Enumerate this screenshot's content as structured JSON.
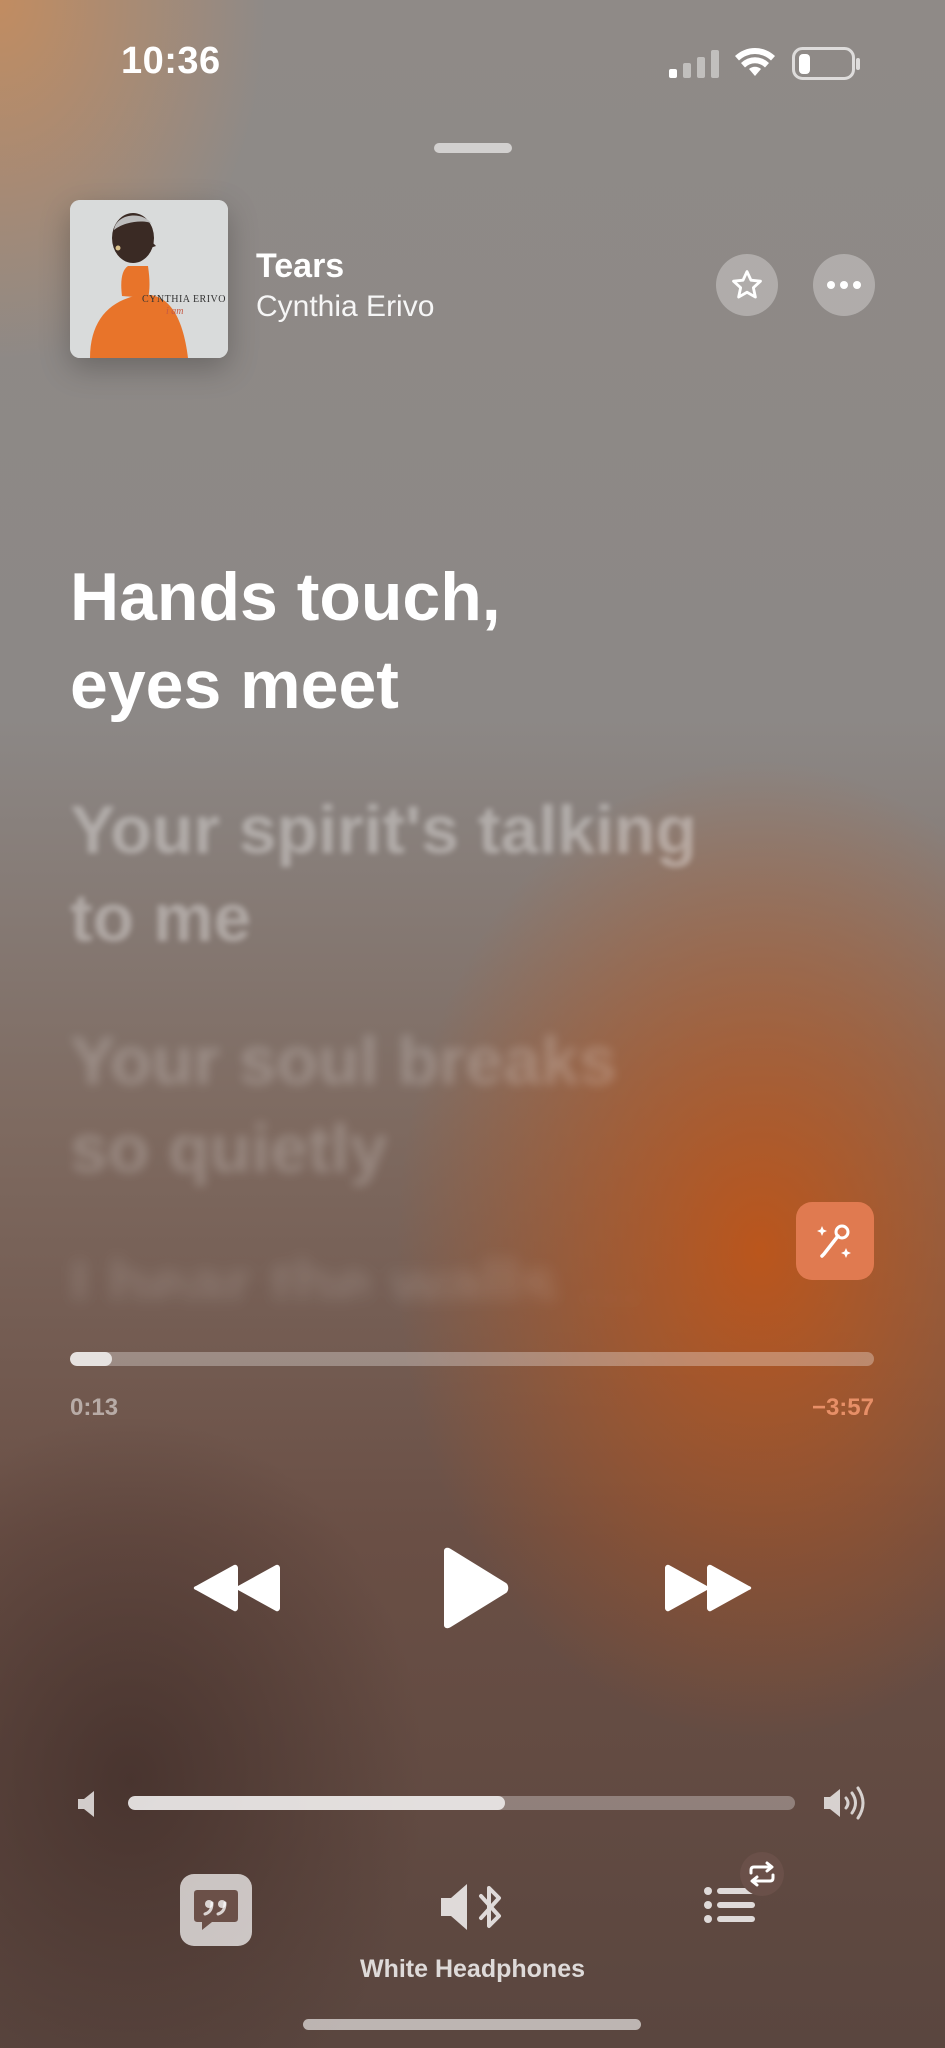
{
  "status": {
    "time": "10:36",
    "signal_icon": "cellular-signal-icon",
    "wifi_icon": "wifi-icon",
    "battery_icon": "battery-icon"
  },
  "now_playing": {
    "title": "Tears",
    "artist": "Cynthia Erivo",
    "artwork": {
      "text_line1": "CYNTHIA ERIVO",
      "text_line2": "i am"
    }
  },
  "lyrics": {
    "active": "Hands touch,\neyes meet",
    "next": [
      "Your spirit's talking\nto me",
      "Your soul breaks\nso quietly",
      "I hear the walls …"
    ]
  },
  "progress": {
    "elapsed": "0:13",
    "remaining": "−3:57",
    "fraction": 0.052
  },
  "volume": {
    "fraction": 0.565
  },
  "output_device": "White Headphones",
  "colors": {
    "sing_button": "#e07a50"
  }
}
